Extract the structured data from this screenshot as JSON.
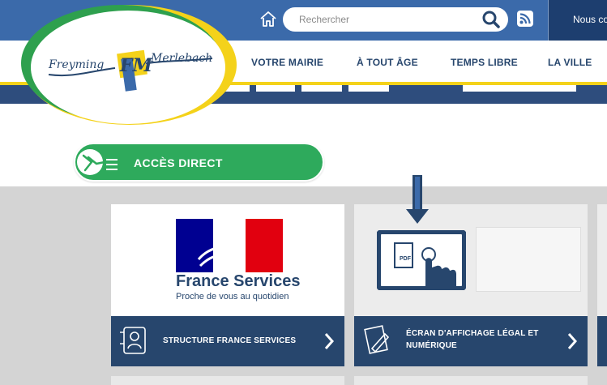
{
  "header": {
    "search": {
      "placeholder": "Rechercher"
    },
    "contact_label": "Nous co",
    "icons": {
      "home": "home-icon",
      "search": "search-icon",
      "rss": "rss-icon"
    }
  },
  "logo": {
    "text_left": "Freyming",
    "text_right": "Merlebach",
    "monogram": "FM"
  },
  "nav": {
    "items": [
      {
        "label": "VOTRE MAIRIE"
      },
      {
        "label": "À TOUT ÂGE"
      },
      {
        "label": "TEMPS LIBRE"
      },
      {
        "label": "LA VILLE"
      }
    ]
  },
  "access": {
    "title": "ACCÈS DIRECT"
  },
  "cards": [
    {
      "logo_title": "France Services",
      "logo_subtitle": "Proche de vous au quotidien",
      "label": "STRUCTURE FRANCE SERVICES"
    },
    {
      "label_line1": "ÉCRAN D'AFFICHAGE LÉGAL ET",
      "label_line2": "NUMÉRIQUE",
      "screen_badge": "PDF"
    }
  ],
  "colors": {
    "topbar": "#3b6aaa",
    "navy": "#27466d",
    "green": "#2eaa5c",
    "yellow": "#f4d21a"
  }
}
